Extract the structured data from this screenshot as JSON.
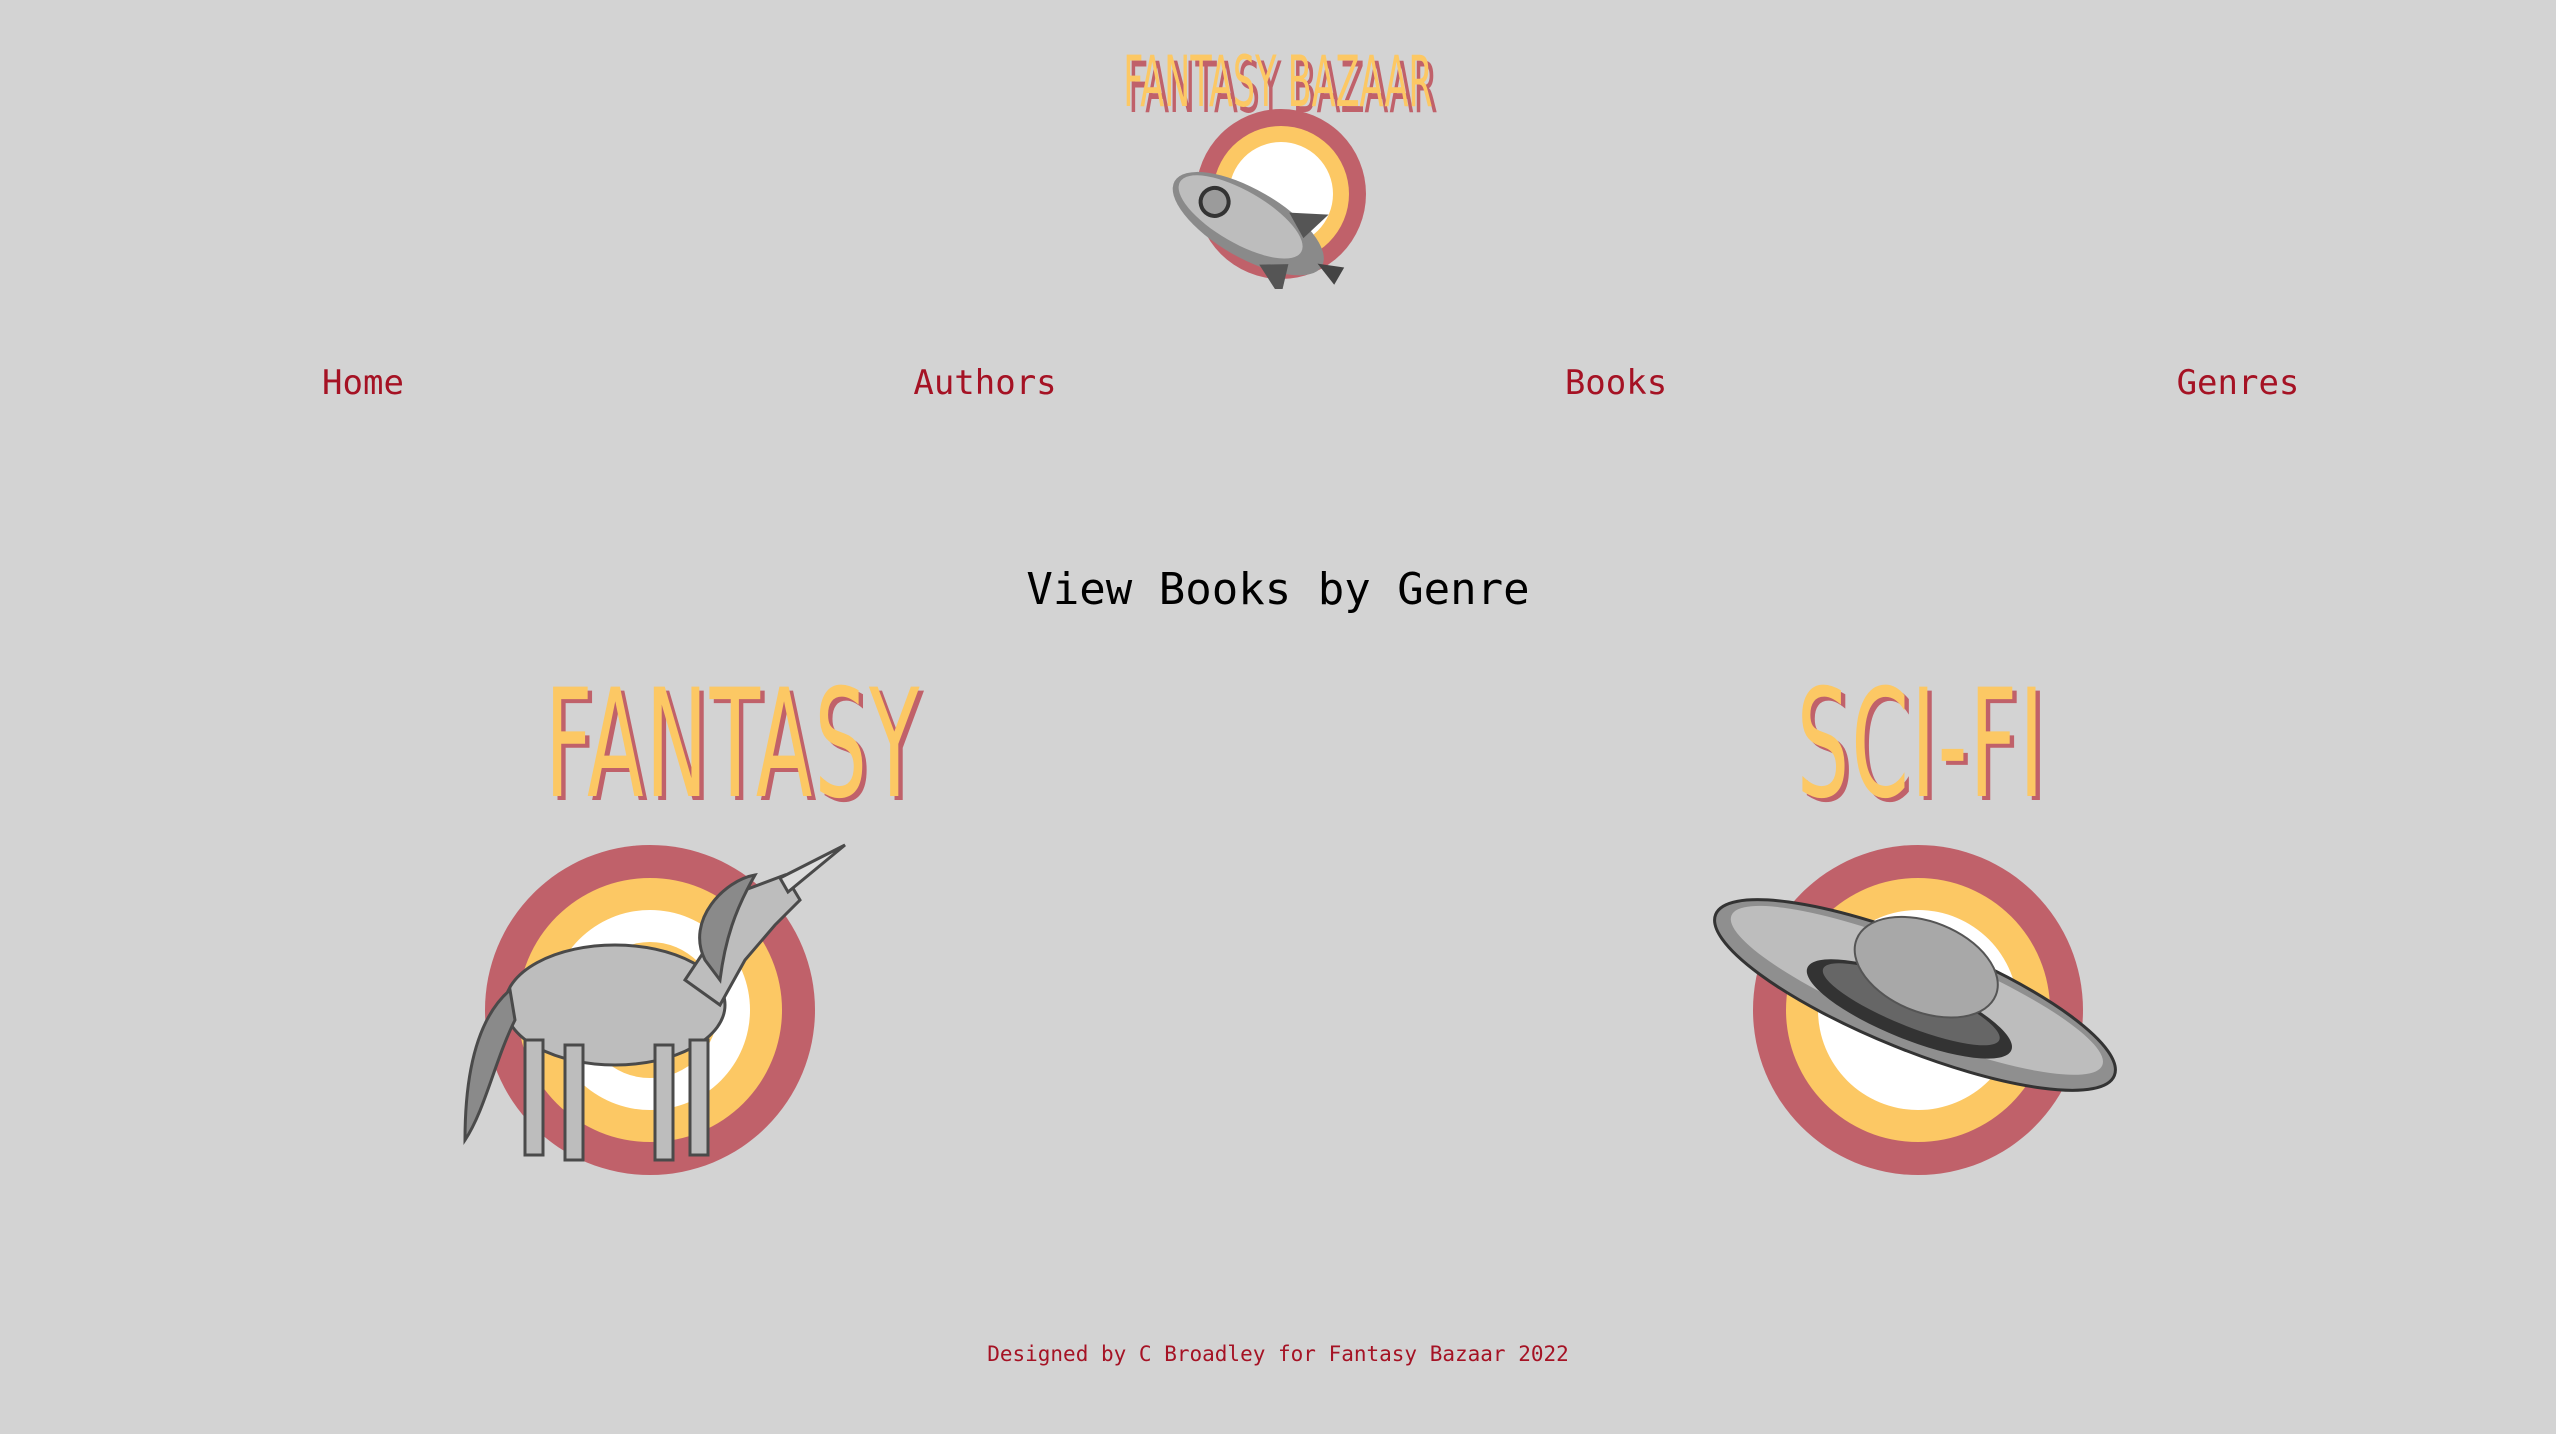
{
  "header": {
    "logo_text": "FANTASY BAZAAR"
  },
  "nav": {
    "home": "Home",
    "authors": "Authors",
    "books": "Books",
    "genres": "Genres"
  },
  "main": {
    "title": "View Books by Genre",
    "genres": [
      {
        "label": "FANTASY",
        "illustration": "unicorn"
      },
      {
        "label": "SCI-FI",
        "illustration": "flying-saucer"
      }
    ]
  },
  "footer": {
    "text": "Designed by C Broadley for Fantasy Bazaar 2022"
  },
  "colors": {
    "background": "#d3d3d3",
    "link": "#a51224",
    "ring_outer": "#c0616a",
    "ring_middle": "#fcc864",
    "ring_inner": "#ffffff"
  }
}
